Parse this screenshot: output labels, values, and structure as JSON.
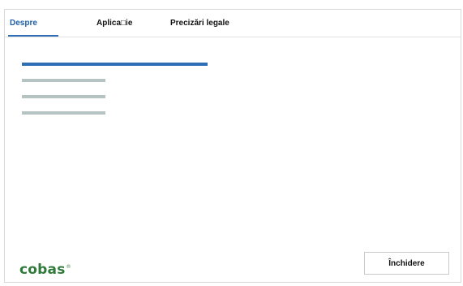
{
  "tabs": [
    {
      "label": "Despre",
      "active": true
    },
    {
      "label": "Aplica□ie",
      "active": false
    },
    {
      "label": "Precizări legale",
      "active": false
    }
  ],
  "logo": {
    "text": "cobas",
    "mark": "®"
  },
  "footer": {
    "close_label": "Închidere"
  },
  "colors": {
    "accent": "#2f6db5",
    "placeholder_line": "#b5c3c3",
    "logo_green": "#2f7a3a"
  }
}
